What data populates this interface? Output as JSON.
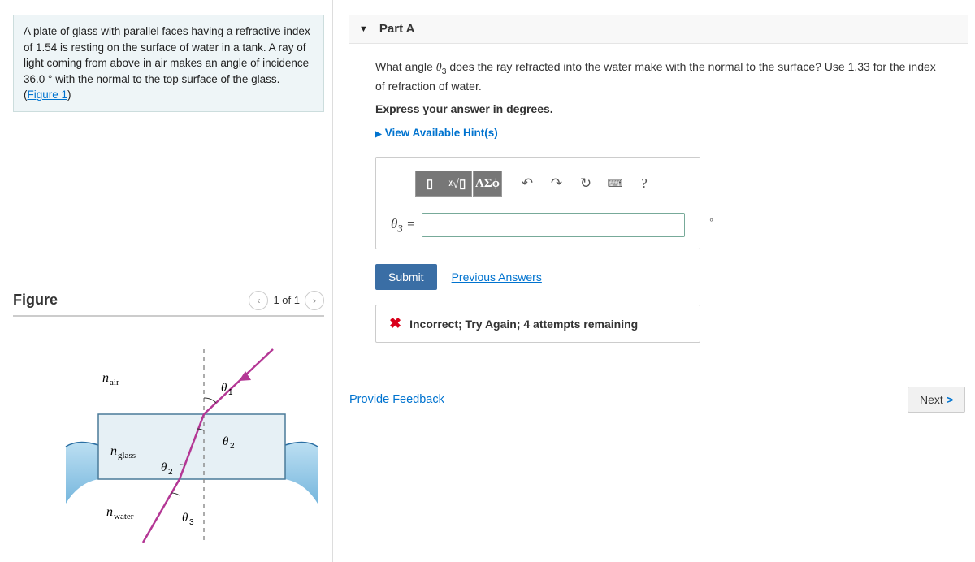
{
  "problem": {
    "text_pre": "A plate of glass with parallel faces having a refractive index of 1.54 is resting on the surface of water in a tank. A ray of light coming from above in air makes an angle of incidence 36.0",
    "text_post": " with the normal to the top surface of the glass. (",
    "figure_link": "Figure 1",
    "text_end": ")"
  },
  "figure": {
    "title": "Figure",
    "pager_text": "1 of 1",
    "labels": {
      "n_air": "air",
      "n_glass": "glass",
      "n_water": "water",
      "theta1": "θ",
      "theta2": "θ",
      "theta2b": "θ",
      "theta3": "θ"
    }
  },
  "part": {
    "title": "Part A",
    "question_pre": "What angle ",
    "question_theta": "θ",
    "question_sub": "3",
    "question_post": " does the ray refracted into the water make with the normal to the surface? Use 1.33 for the index of refraction of water.",
    "instruction": "Express your answer in degrees.",
    "hints_label": "View Available Hint(s)",
    "toolbar": {
      "templates": "▯",
      "roots": "ᵡ√▯",
      "greek": "ΑΣϕ",
      "help": "?"
    },
    "theta_label": "θ",
    "theta_sub": "3",
    "equals": " = ",
    "unit_mark": "∘",
    "submit": "Submit",
    "previous": "Previous Answers",
    "feedback": "Incorrect; Try Again; 4 attempts remaining"
  },
  "footer": {
    "feedback_link": "Provide Feedback",
    "next": "Next"
  }
}
